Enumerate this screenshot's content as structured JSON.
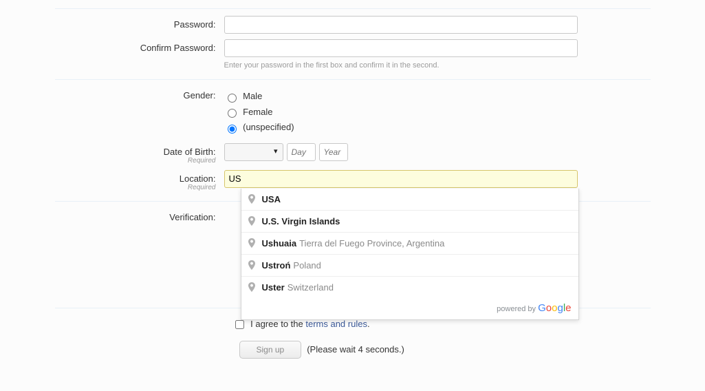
{
  "labels": {
    "password": "Password:",
    "confirm_password": "Confirm Password:",
    "password_hint": "Enter your password in the first box and confirm it in the second.",
    "gender": "Gender:",
    "dob": "Date of Birth:",
    "location": "Location:",
    "verification": "Verification:",
    "required": "Required"
  },
  "gender_opts": {
    "male": "Male",
    "female": "Female",
    "unspecified": "(unspecified)"
  },
  "dob": {
    "day_ph": "Day",
    "year_ph": "Year"
  },
  "location": {
    "value": "US",
    "suggestions": [
      {
        "match": "US",
        "rest": "A",
        "secondary": ""
      },
      {
        "match": "U",
        "rest": ".S. Virgin Islands",
        "secondary": ""
      },
      {
        "match": "Us",
        "rest": "huaia",
        "secondary": "Tierra del Fuego Province, Argentina"
      },
      {
        "match": "Us",
        "rest": "troń",
        "secondary": "Poland"
      },
      {
        "match": "Us",
        "rest": "ter",
        "secondary": "Switzerland"
      }
    ],
    "powered_by": "powered by "
  },
  "agree": {
    "prefix": "I agree to the ",
    "link": "terms and rules",
    "suffix": "."
  },
  "submit": {
    "button": "Sign up",
    "wait": "(Please wait 4 seconds.)"
  }
}
